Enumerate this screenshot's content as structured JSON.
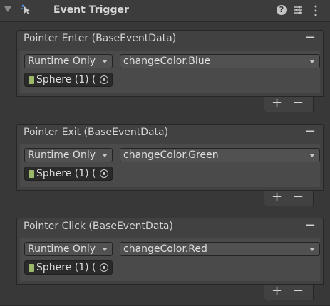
{
  "component": {
    "title": "Event Trigger",
    "icons": [
      "foldout-arrow-icon",
      "event-trigger-icon",
      "help-icon",
      "preset-icon",
      "kebab-menu-icon"
    ]
  },
  "events": [
    {
      "title": "Pointer Enter (BaseEventData)",
      "call_state": "Runtime Only",
      "method": "changeColor.Blue",
      "target": "Sphere (1) ("
    },
    {
      "title": "Pointer Exit (BaseEventData)",
      "call_state": "Runtime Only",
      "method": "changeColor.Green",
      "target": "Sphere (1) ("
    },
    {
      "title": "Pointer Click (BaseEventData)",
      "call_state": "Runtime Only",
      "method": "changeColor.Red",
      "target": "Sphere (1) ("
    }
  ],
  "buttons": {
    "remove": "−",
    "add": "+",
    "remove_listener": "−"
  },
  "help_glyph": "?"
}
